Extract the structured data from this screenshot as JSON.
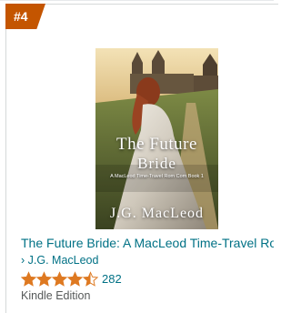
{
  "product": {
    "rank": "#4",
    "cover": {
      "title_line1": "The Future",
      "title_line2": "Bride",
      "series_line": "A MacLeod Time-Travel Rom Com Book 1",
      "author": "J.G. MacLeod"
    },
    "title": "The Future Bride: A MacLeod Time-Travel Rom Com",
    "author_link": "› J.G. MacLeod",
    "rating": 4.5,
    "rating_max": 5,
    "review_count": "282",
    "format": "Kindle Edition",
    "colors": {
      "badge": "#c45500",
      "link": "#007185",
      "star": "#de7921",
      "muted": "#565959"
    },
    "icons": [
      "star-icon",
      "half-star-icon"
    ]
  }
}
